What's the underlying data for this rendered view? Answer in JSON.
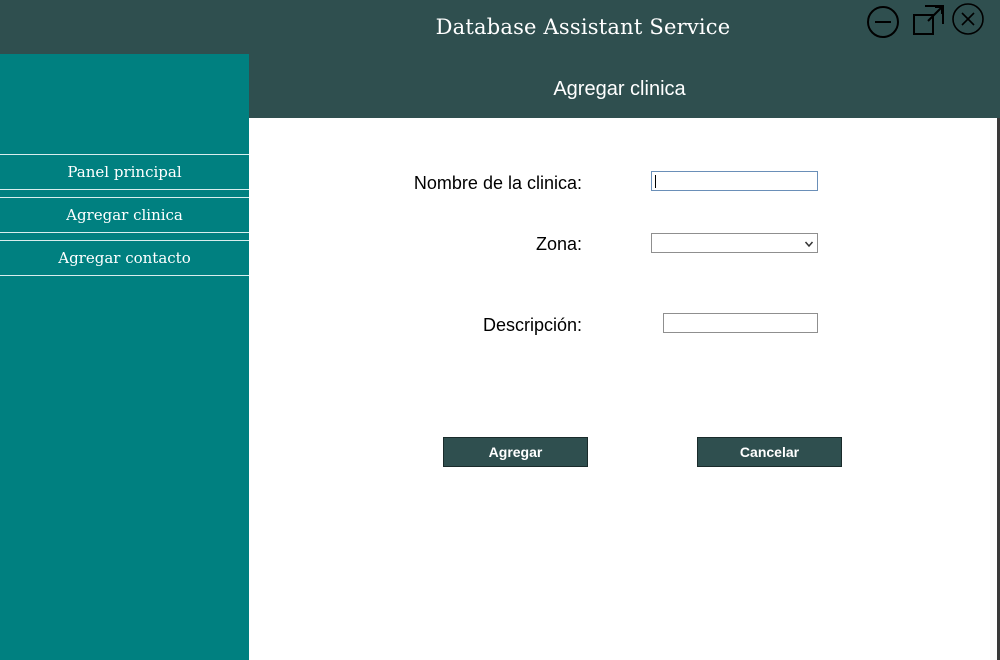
{
  "window": {
    "title": "Database Assistant Service",
    "controls": {
      "minimize_icon": "minimize-circle-icon",
      "maximize_icon": "maximize-square-icon",
      "close_icon": "close-circle-icon"
    }
  },
  "sidebar": {
    "items": [
      {
        "label": "Panel principal"
      },
      {
        "label": "Agregar clinica"
      },
      {
        "label": "Agregar contacto"
      }
    ]
  },
  "main": {
    "title": "Agregar clinica",
    "form": {
      "name_label": "Nombre de la clinica:",
      "name_value": "",
      "zone_label": "Zona:",
      "zone_value": "",
      "description_label": "Descripción:",
      "description_value": ""
    },
    "buttons": {
      "add_label": "Agregar",
      "cancel_label": "Cancelar"
    }
  },
  "colors": {
    "header_bg": "#2f4f4f",
    "sidebar_bg": "#008080",
    "content_bg": "#ffffff",
    "button_bg": "#2f4f4f"
  }
}
